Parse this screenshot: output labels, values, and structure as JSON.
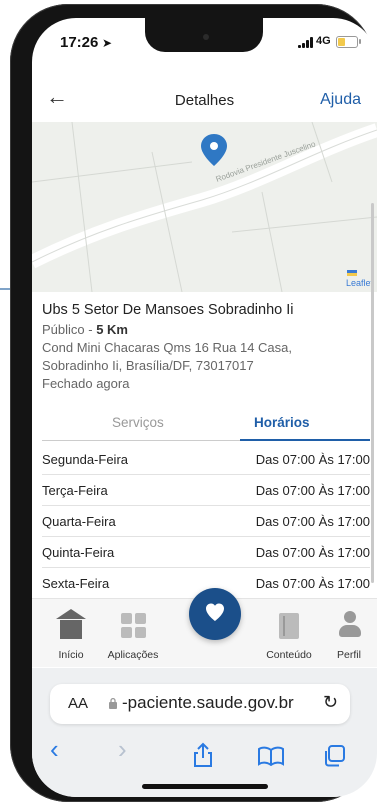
{
  "status": {
    "time": "17:26",
    "network": "4G"
  },
  "appbar": {
    "title": "Detalhes",
    "help": "Ajuda"
  },
  "map": {
    "road_label": "Rodovia Presidente Juscelino",
    "attribution": "Leaflet"
  },
  "facility": {
    "name": "Ubs 5 Setor De Mansoes Sobradinho Ii",
    "type": "Público",
    "separator": " - ",
    "distance": "5 Km",
    "address_line1": "Cond Mini Chacaras Qms 16 Rua 14 Casa,",
    "address_line2": "Sobradinho Ii, Brasília/DF, 73017017",
    "status": "Fechado agora"
  },
  "tabs": [
    {
      "label": "Serviços",
      "active": false
    },
    {
      "label": "Horários",
      "active": true
    }
  ],
  "schedule": [
    {
      "day": "Segunda-Feira",
      "hours": "Das 07:00 Às 17:00"
    },
    {
      "day": "Terça-Feira",
      "hours": "Das 07:00 Às 17:00"
    },
    {
      "day": "Quarta-Feira",
      "hours": "Das 07:00 Às 17:00"
    },
    {
      "day": "Quinta-Feira",
      "hours": "Das 07:00 Às 17:00"
    },
    {
      "day": "Sexta-Feira",
      "hours": "Das 07:00 Às 17:00"
    }
  ],
  "nav": {
    "inicio": "Início",
    "aplicacoes": "Aplicações",
    "conteudo": "Conteúdo",
    "perfil": "Perfil"
  },
  "browser": {
    "aa": "AA",
    "url": "-paciente.saude.gov.br"
  },
  "colors": {
    "primary": "#1f5ea8",
    "fab": "#1b4f8a",
    "pin": "#2f78c4"
  }
}
